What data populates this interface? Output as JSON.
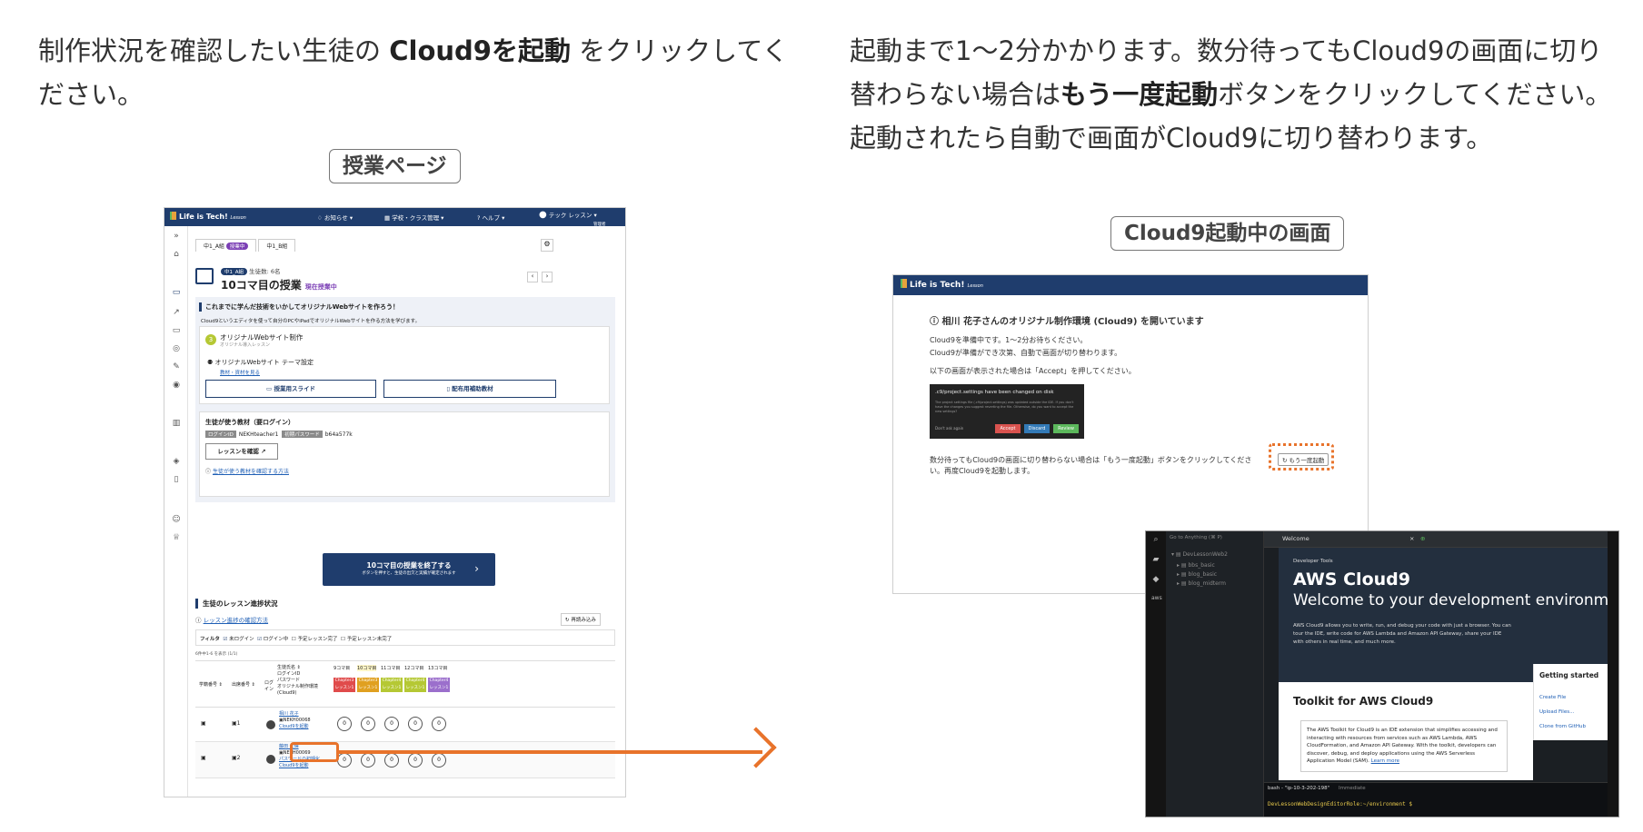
{
  "instructions": {
    "left": {
      "pre": "制作状況を確認したい生徒の ",
      "strong": "Cloud9を起動",
      "post": " をクリックしてください。"
    },
    "right": {
      "p1_pre": "起動まで1〜2分かかります。数分待ってもCloud9の画面に切り替わらない場合は",
      "p1_strong": "もう一度起動",
      "p1_post": "ボタンをクリックしてください。",
      "p2": "起動されたら自動で画面がCloud9に切り替わります。"
    }
  },
  "captions": {
    "left": "授業ページ",
    "right": "Cloud9起動中の画面"
  },
  "lesson_page": {
    "logo": "Life is Tech!",
    "logo_sub": "Lesson",
    "nav": {
      "notice": "お知らせ ▾",
      "school": "学校・クラス管理 ▾",
      "help": "ヘルプ ▾",
      "user": "テック レッスン",
      "user_role": "管理者"
    },
    "tabs": [
      "中1_A組",
      "中1_B組"
    ],
    "tab_badge": "授業中",
    "class_badge": "中1_A組",
    "student_count": "生徒数: 6名",
    "lesson_title": "10コマ目の授業",
    "lesson_status": "現在授業中",
    "goal_title": "これまでに学んだ技術をいかしてオリジナルWebサイトを作ろう！",
    "goal_desc": "Cloud9というエディタを使って自分のPCやiPadでオリジナルWebサイトを作る方法を学びます。",
    "course_num": "3",
    "course_name": "オリジナルWebサイト制作",
    "course_sub": "オリジナル導入レッスン",
    "theme": "オリジナルWebサイト テーマ設定",
    "materials_link": "教材・資材を見る",
    "slides_btn": "授業用スライド",
    "handout_btn": "配布用補助教材",
    "student_materials_title": "生徒が使う教材（要ログイン）",
    "login_id_label": "ログインID",
    "login_id": "NEKHteacher1",
    "pw_label": "初期パスワード",
    "pw": "b64a577k",
    "lesson_check_btn": "レッスンを確認",
    "howto_link": "生徒が使う教材を確認する方法",
    "end_btn": "10コマ目の授業を終了する",
    "end_btn_sub": "ボタンを押すと、生徒の出欠と実績が確定されます",
    "progress_title": "生徒のレッスン進捗状況",
    "progress_howto": "レッスン進捗の確認方法",
    "reload_btn": "再読み込み",
    "filter_label": "フィルタ",
    "filters": [
      "未ログイン",
      "ログイン中",
      "予定レッスン完了",
      "予定レッスン未完了"
    ],
    "count_label": "6件中1-6 を表示 (1/1)",
    "columns": [
      "学籍番号 ⇕",
      "出席番号 ⇕",
      "ログイン",
      "生徒氏名 ⇕",
      "9コマ目",
      "10コマ目",
      "11コマ目",
      "12コマ目",
      "13コマ目"
    ],
    "name_col_sub": [
      "ログインID",
      "パスワード",
      "オリジナル制作環境",
      "(Cloud9)"
    ],
    "chapter_tags": [
      "Chapter3",
      "Chapter3",
      "Chapter4",
      "Chapter4",
      "Chapter4"
    ],
    "chapter_sub": "レッスン1",
    "rows": [
      {
        "no": "1",
        "name": "相川 花子",
        "id": "NEKH00068",
        "action": "Cloud9を起動",
        "circles": [
          "0",
          "0",
          "0",
          "0",
          "0"
        ]
      },
      {
        "no": "2",
        "name": "藤田 大輝",
        "id": "NEKH00069",
        "pw_link": "パスワードの初期化",
        "action": "Cloud9を起動",
        "circles": [
          "0",
          "0",
          "0",
          "0",
          "0"
        ]
      }
    ]
  },
  "startup_page": {
    "logo": "Life is Tech!",
    "logo_sub": "Lesson",
    "title": "相川 花子さんのオリジナル制作環境 (Cloud9) を開いています",
    "line1": "Cloud9を準備中です。1〜2分お待ちください。",
    "line2": "Cloud9が準備ができ次第、自動で画面が切り替わります。",
    "line3": "以下の画面が表示された場合は「Accept」を押してください。",
    "dialog_title": ".c9/project.settings have been changed on disk",
    "dialog_body": "The project settings file (.c9/project.settings) was updated outside the IDE. If you don't have the changes you suggest reverting the file. Otherwise, do you want to accept the new settings?",
    "dialog_check": "Don't ask again",
    "dialog_buttons": [
      "Accept",
      "Discard",
      "Review"
    ],
    "retry_text": "数分待ってもCloud9の画面に切り替わらない場合は「もう一度起動」ボタンをクリックしてください。再度Cloud9を起動します。",
    "retry_btn": "もう一度起動"
  },
  "aws": {
    "search": "Go to Anything (⌘ P)",
    "tree_root": "DevLessonWeb2",
    "tree_items": [
      "bbs_basic",
      "blog_basic",
      "blog_midterm"
    ],
    "tab_welcome": "Welcome",
    "dev_tools": "Developer Tools",
    "title": "AWS Cloud9",
    "subtitle": "Welcome to your development environm",
    "desc": "AWS Cloud9 allows you to write, run, and debug your code with just a browser. You can tour the IDE, write code for AWS Lambda and Amazon API Gateway, share your IDE with others in real time, and much more.",
    "toolkit_title": "Toolkit for AWS Cloud9",
    "toolkit_desc": "The AWS Toolkit for Cloud9 is an IDE extension that simplifies accessing and interacting with resources from services such as AWS Lambda, AWS CloudFormation, and Amazon API Gateway. With the toolkit, developers can discover, debug, and deploy applications using the AWS Serverless Application Model (SAM).",
    "learn_more": "Learn more",
    "getting_started": "Getting started",
    "gs_links": [
      "Create File",
      "Upload Files...",
      "Clone from GitHub"
    ],
    "term_tab": "bash - \"ip-10-3-202-198\"",
    "term_tab2": "Immediate",
    "prompt": "DevLessonWebDesignEditorRole:~/environment $"
  },
  "colors": {
    "navy": "#1f3d6d",
    "accent": "#e8732b",
    "purple": "#7b3fb5"
  }
}
